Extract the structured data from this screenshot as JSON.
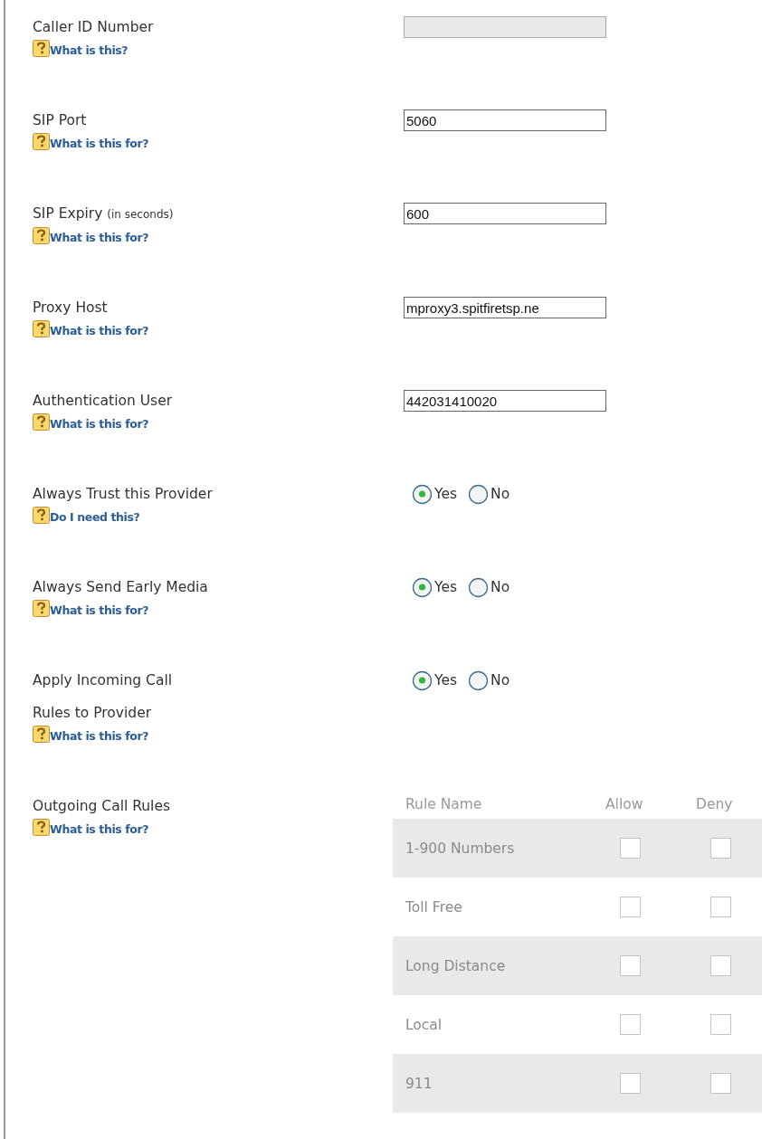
{
  "fields": [
    {
      "kind": "text",
      "label_lines": [
        "Caller ID Number"
      ],
      "disabled": true,
      "help": "What is this?"
    },
    {
      "kind": "text",
      "label_lines": [
        "SIP Port"
      ],
      "disabled": false,
      "value": "5060",
      "help": "What is this for?"
    },
    {
      "kind": "text",
      "label_lines": [
        "SIP Expiry"
      ],
      "note": "(in seconds)",
      "disabled": false,
      "value": "600",
      "help": "What is this for?"
    },
    {
      "kind": "text",
      "label_lines": [
        "Proxy Host"
      ],
      "disabled": false,
      "value": "mproxy3.spitfiretsp.ne",
      "help": "What is this for?"
    },
    {
      "kind": "text",
      "label_lines": [
        "Authentication User"
      ],
      "disabled": false,
      "value": "442031410020",
      "help": "What is this for?"
    },
    {
      "kind": "radio",
      "label_lines": [
        "Always Trust this Provider"
      ],
      "options": [
        {
          "label": "Yes",
          "selected": true
        },
        {
          "label": "No",
          "selected": false
        }
      ],
      "help": "Do I need this?"
    },
    {
      "kind": "radio",
      "label_lines": [
        "Always Send Early Media"
      ],
      "options": [
        {
          "label": "Yes",
          "selected": true
        },
        {
          "label": "No",
          "selected": false
        }
      ],
      "help": "What is this for?"
    },
    {
      "kind": "radio",
      "label_lines": [
        "Apply Incoming Call",
        "Rules to Provider"
      ],
      "options": [
        {
          "label": "Yes",
          "selected": true
        },
        {
          "label": "No",
          "selected": false
        }
      ],
      "help": "What is this for?"
    },
    {
      "kind": "rules",
      "label_lines": [
        "Outgoing Call Rules"
      ],
      "help": "What is this for?",
      "disabled": true,
      "columns": [
        "Rule Name",
        "Allow",
        "Deny"
      ],
      "rows": [
        {
          "name": "1-900 Numbers",
          "allow": false,
          "deny": false
        },
        {
          "name": "Toll Free",
          "allow": false,
          "deny": false
        },
        {
          "name": "Long Distance",
          "allow": false,
          "deny": false
        },
        {
          "name": "Local",
          "allow": false,
          "deny": false
        },
        {
          "name": "911",
          "allow": false,
          "deny": false
        }
      ]
    }
  ]
}
